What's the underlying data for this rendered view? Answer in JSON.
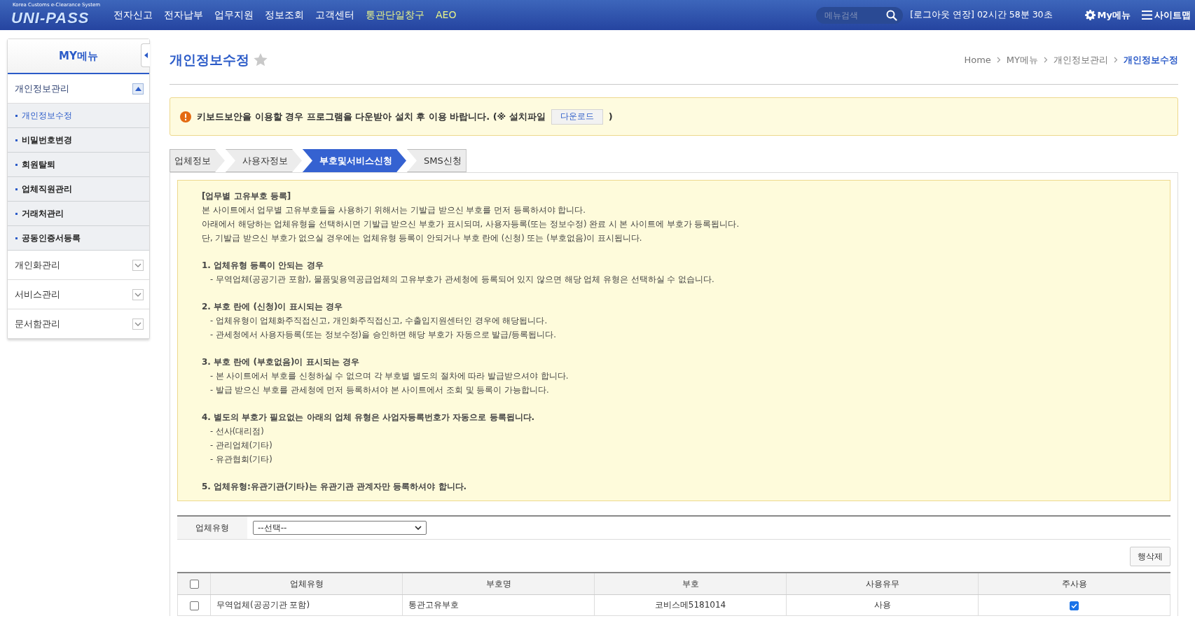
{
  "header": {
    "logo": {
      "subtitle": "Korea Customs e-Clearance System",
      "name": "UNI-PASS"
    },
    "nav": [
      {
        "label": "전자신고",
        "highlight": false
      },
      {
        "label": "전자납부",
        "highlight": false
      },
      {
        "label": "업무지원",
        "highlight": false
      },
      {
        "label": "정보조회",
        "highlight": false
      },
      {
        "label": "고객센터",
        "highlight": false
      },
      {
        "label": "통관단일창구",
        "highlight": true
      },
      {
        "label": "AEO",
        "highlight": true
      }
    ],
    "search": {
      "placeholder": "메뉴검색"
    },
    "session_timer": "[로그아웃 연장] 02시간 58분 30초",
    "links": [
      {
        "label": "My메뉴",
        "kind": "gear"
      },
      {
        "label": "사이트맵",
        "kind": "menu"
      }
    ]
  },
  "sidebar": {
    "title": "MY메뉴",
    "groups": [
      {
        "label": "개인정보관리",
        "expanded": true,
        "items": [
          {
            "label": "개인정보수정",
            "selected": true
          },
          {
            "label": "비밀번호변경",
            "selected": false
          },
          {
            "label": "회원탈퇴",
            "selected": false
          },
          {
            "label": "업체직원관리",
            "selected": false
          },
          {
            "label": "거래처관리",
            "selected": false
          },
          {
            "label": "공동인증서등록",
            "selected": false
          }
        ]
      },
      {
        "label": "개인화관리",
        "expanded": false
      },
      {
        "label": "서비스관리",
        "expanded": false
      },
      {
        "label": "문서함관리",
        "expanded": false
      }
    ]
  },
  "page_title": "개인정보수정",
  "breadcrumb": [
    "Home",
    "MY메뉴",
    "개인정보관리",
    "개인정보수정"
  ],
  "notice": {
    "text": "키보드보안을 이용할 경우 프로그램을 다운받아 설치 후 이용 바랍니다. (※ 설치파일",
    "button": "다운로드",
    "suffix": ")"
  },
  "tabs": [
    {
      "label": "업체정보",
      "selected": false
    },
    {
      "label": "사용자정보",
      "selected": false
    },
    {
      "label": "부호및서비스신청",
      "selected": true
    },
    {
      "label": "SMS신청",
      "selected": false
    }
  ],
  "info": {
    "title": "[업무별 고유부호 등록]",
    "lines": [
      "본 사이트에서 업무별 고유부호들을 사용하기 위해서는 기발급 받으신 부호를 먼저 등록하셔야 합니다.",
      "아래에서 해당하는 업체유형을 선택하시면 기발급 받으신 부호가 표시되며, 사용자등록(또는 정보수정) 완료 시 본 사이트에 부호가 등록됩니다.",
      "단, 기발급 받으신 부호가 없으실 경우에는 업체유형 등록이 안되거나 부호 란에 (신청) 또는 (부호없음)이 표시됩니다."
    ],
    "sections": [
      {
        "title": "1. 업체유형 등록이 안되는 경우",
        "items": [
          "- 무역업체(공공기관 포함), 물품및용역공급업체의 고유부호가 관세청에 등록되어 있지 않으면 해당 업체 유형은 선택하실 수 없습니다."
        ]
      },
      {
        "title": "2. 부호 란에 (신청)이 표시되는 경우",
        "items": [
          "- 업체유형이 업체화주직접신고, 개인화주직접신고, 수출입지원센터인 경우에 해당됩니다.",
          "- 관세청에서 사용자등록(또는 정보수정)을 승인하면 해당 부호가 자동으로 발급/등록됩니다."
        ]
      },
      {
        "title": "3. 부호 란에 (부호없음)이 표시되는 경우",
        "items": [
          "- 본 사이트에서 부호를 신청하실 수 없으며 각 부호별 별도의 절차에 따라 발급받으셔야 합니다.",
          "- 발급 받으신 부호를 관세청에 먼저 등록하셔야 본 사이트에서 조회 및 등록이 가능합니다."
        ]
      },
      {
        "title": "4. 별도의 부호가 필요없는 아래의 업체 유형은 사업자등록번호가 자동으로 등록됩니다.",
        "items": [
          "- 선사(대리점)",
          "- 관리업체(기타)",
          "- 유관협회(기타)"
        ]
      },
      {
        "title": "5. 업체유형:유관기관(기타)는 유관기관 관계자만 등록하셔야 합니다."
      }
    ]
  },
  "form": {
    "label": "업체유형",
    "select": "--선택--"
  },
  "delete_button": "행삭제",
  "table": {
    "header_checked": false,
    "columns": [
      "업체유형",
      "부호명",
      "부호",
      "사용유무",
      "주사용"
    ],
    "rows": [
      {
        "checked": false,
        "cells": [
          "무역업체(공공기관 포함)",
          "통관고유부호",
          "코비스메5181014",
          "사용"
        ],
        "main_use": true
      }
    ]
  }
}
